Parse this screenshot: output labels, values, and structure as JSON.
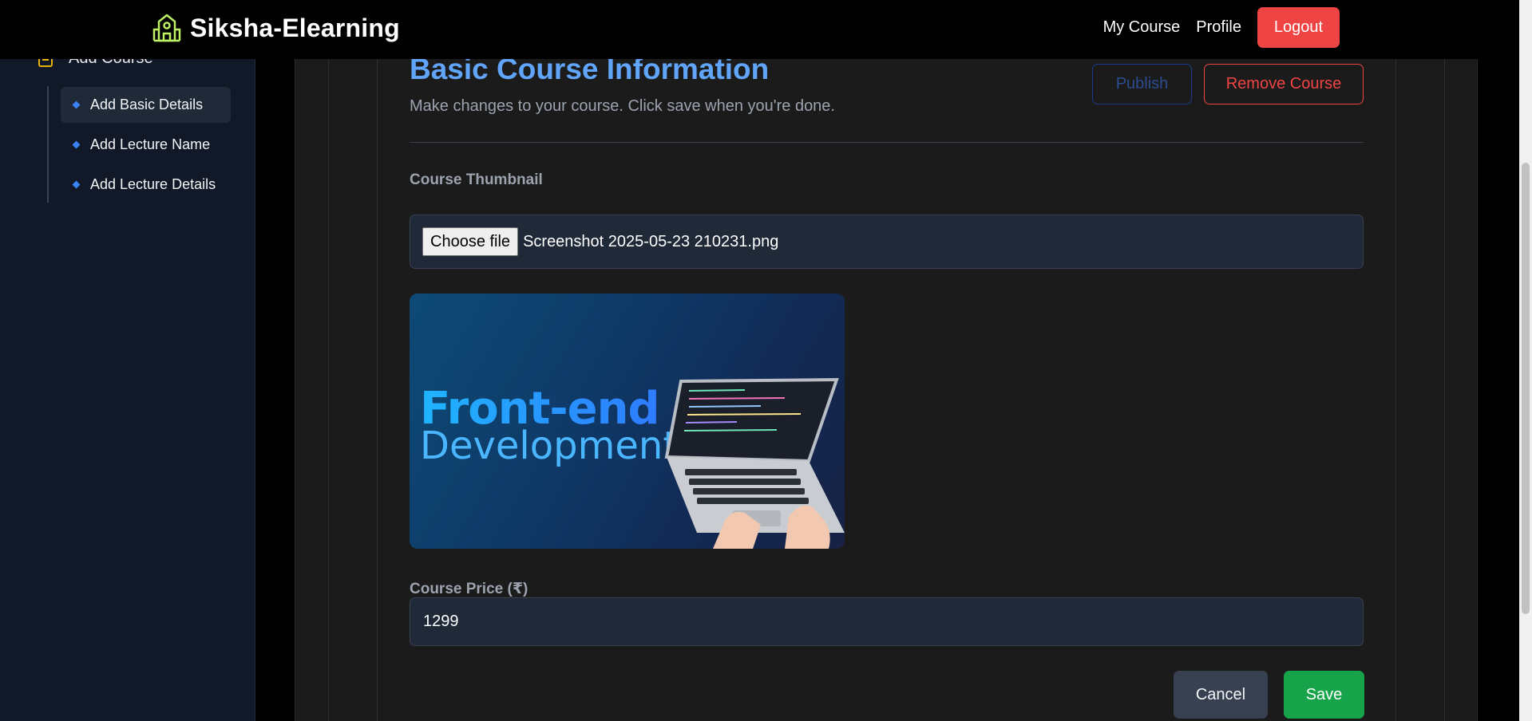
{
  "navbar": {
    "brand": "Siksha-Elearning",
    "links": {
      "my_course": "My Course",
      "profile": "Profile"
    },
    "logout_label": "Logout"
  },
  "sidebar": {
    "top_item": "Add Course",
    "sub_items": [
      {
        "label": "Add Basic Details",
        "active": true
      },
      {
        "label": "Add Lecture Name",
        "active": false
      },
      {
        "label": "Add Lecture Details",
        "active": false
      }
    ]
  },
  "main": {
    "title": "Basic Course Information",
    "subtitle": "Make changes to your course. Click save when you're done.",
    "publish_label": "Publish",
    "remove_label": "Remove Course",
    "thumbnail_label": "Course Thumbnail",
    "choose_file_label": "Choose file",
    "file_name": "Screenshot 2025-05-23 210231.png",
    "thumbnail_text": {
      "line1": "Front-end",
      "line2": "Development"
    },
    "price_label": "Course Price (₹)",
    "price_value": "1299",
    "cancel_label": "Cancel",
    "save_label": "Save"
  },
  "colors": {
    "accent_title": "#60a5fa",
    "logout": "#ef4444",
    "save": "#16a34a",
    "brand_icon": "#bef264"
  },
  "icons": {
    "brand": "school-icon",
    "sidebar_top": "notebook-icon",
    "sub_item": "diamond-bullet-icon"
  }
}
